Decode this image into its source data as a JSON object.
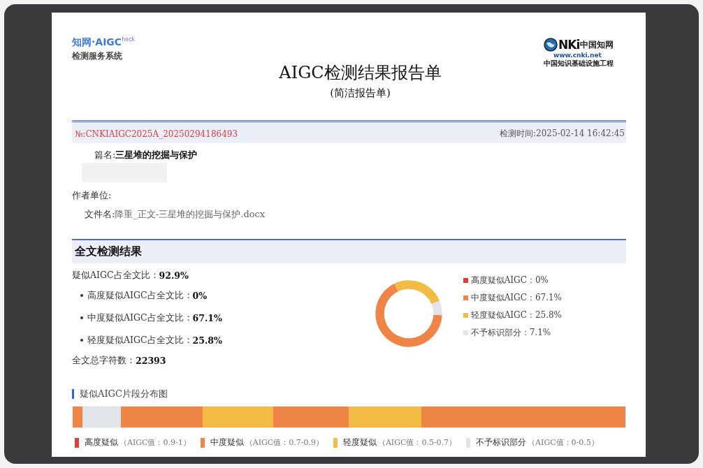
{
  "logo_left": {
    "brand": "知网·AIGC",
    "brand_suffix": "heck",
    "subtitle": "检测服务系统"
  },
  "logo_right": {
    "mark": "NKi",
    "brand": "中国知网",
    "url": "www.cnki.net",
    "slogan": "中国知识基础设施工程"
  },
  "title": "AIGC检测结果报告单",
  "subtitle": "(简洁报告单)",
  "header_band": {
    "number": "№:CNKIAIGC2025A_20250294186493",
    "time": "检测时间:2025-02-14 16:42:45"
  },
  "info": [
    {
      "label": "篇名:",
      "value": "三星堆的挖掘与保护",
      "bold": true
    },
    {
      "label": "作者单位:"
    },
    {
      "label": "文件名:",
      "value": "降重_正文-三星堆的挖掘与保护.docx",
      "bold": false
    }
  ],
  "section_title": "全文检测结果",
  "stats": {
    "total": {
      "label": "疑似AIGC占全文比：",
      "value": "92.9%"
    },
    "breakdown": [
      {
        "label": "高度疑似AIGC占全文比：",
        "value": "0%"
      },
      {
        "label": "中度疑似AIGC占全文比：",
        "value": "67.1%"
      },
      {
        "label": "轻度疑似AIGC占全文比：",
        "value": "25.8%"
      }
    ],
    "char_count": {
      "label": "全文总字符数：",
      "value": "22393"
    }
  },
  "chart_data": {
    "type": "donut",
    "categories": [
      "高度疑似AIGC",
      "中度疑似AIGC",
      "轻度疑似AIGC",
      "不予标识部分"
    ],
    "series": [
      {
        "values": [
          0,
          67.1,
          25.8,
          7.1
        ]
      }
    ],
    "colors": [
      "#e03c3c",
      "#ef8447",
      "#f2bb43",
      "#e1e4e8"
    ],
    "value_labels": [
      "：0%",
      "：67.1%",
      "：25.8%",
      "：7.1%"
    ]
  },
  "distribution": {
    "title": "疑似AIGC片段分布图",
    "segments": [
      {
        "kind": "medium"
      },
      {
        "kind": "none"
      },
      {
        "kind": "medium"
      },
      {
        "kind": "light"
      },
      {
        "kind": "medium"
      },
      {
        "kind": "light"
      },
      {
        "kind": "medium"
      }
    ],
    "legend": [
      {
        "kind": "high",
        "label": "高度疑似",
        "range": "（AIGC值：0.9-1）"
      },
      {
        "kind": "medium",
        "label": "中度疑似",
        "range": "（AIGC值：0.7-0.9）"
      },
      {
        "kind": "light",
        "label": "轻度疑似",
        "range": "（AIGC值：0.5-0.7）"
      },
      {
        "kind": "none",
        "label": "不予标识部分",
        "range": "（AIGC值：0-0.5）"
      }
    ]
  }
}
